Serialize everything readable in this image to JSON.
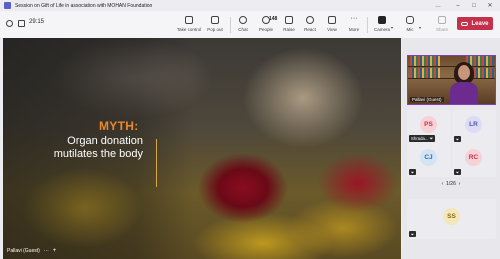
{
  "window": {
    "title": "Session on Gift of Life in association with MOHAN Foundation",
    "controls": [
      "…",
      "–",
      "□",
      "✕"
    ]
  },
  "toolbar": {
    "timer": "29:15",
    "buttons": [
      {
        "label": "Take control",
        "icon": "take-control-icon"
      },
      {
        "label": "Pop out",
        "icon": "pop-out-icon"
      },
      {
        "label": "Chat",
        "icon": "chat-icon"
      },
      {
        "label": "People",
        "icon": "people-icon",
        "count": "148"
      },
      {
        "label": "Raise",
        "icon": "raise-hand-icon"
      },
      {
        "label": "React",
        "icon": "react-icon"
      },
      {
        "label": "View",
        "icon": "view-icon"
      },
      {
        "label": "More",
        "icon": "more-icon"
      },
      {
        "label": "Camera",
        "icon": "camera-icon"
      },
      {
        "label": "Mic",
        "icon": "mic-icon"
      },
      {
        "label": "Share",
        "icon": "share-icon"
      }
    ],
    "leave_label": "Leave"
  },
  "slide": {
    "heading": "MYTH:",
    "text": "Organ donation mutilates the body",
    "presenter": "Pallavi (Guest)",
    "menu_dots": "···",
    "plus": "+"
  },
  "gallery": {
    "video_name": "Pallavi (Guest)",
    "tiles": [
      {
        "initials": "PS",
        "name": "Shrada...",
        "color": "#c4314b",
        "bg": "#f6d1d6"
      },
      {
        "initials": "LR",
        "color": "#4f52b2",
        "bg": "#dcdcf5"
      },
      {
        "initials": "CJ",
        "color": "#2a6cb0",
        "bg": "#d3e4f5"
      },
      {
        "initials": "RC",
        "color": "#c4314b",
        "bg": "#f6d1d6"
      },
      {
        "initials": "SS",
        "color": "#8a6a10",
        "bg": "#f4e7bb"
      }
    ],
    "pager": "1/26"
  },
  "colors": {
    "accent": "#5b5fc7",
    "leave": "#c4314b",
    "myth": "#e8892a"
  }
}
